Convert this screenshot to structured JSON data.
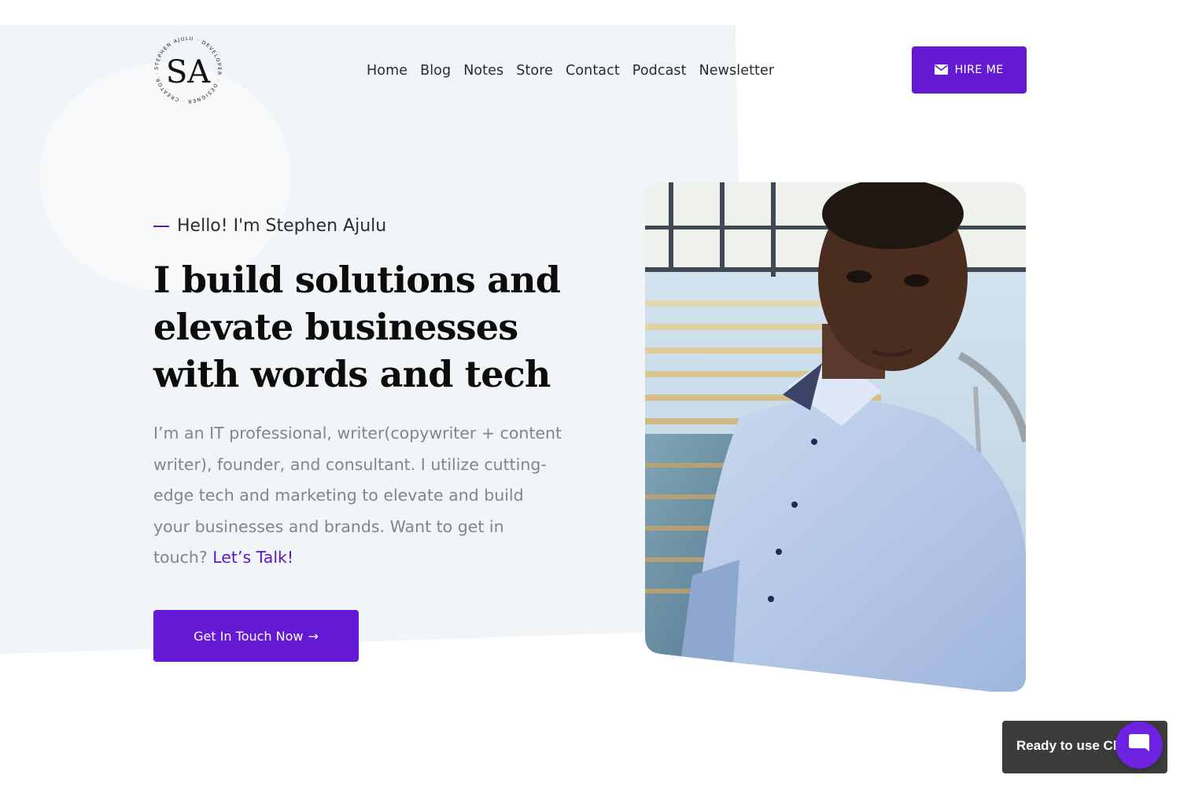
{
  "brand": {
    "logo_monogram": "SA",
    "logo_ring_text": "STEPHEN AJULU · DEVELOPER · DESIGNER · CREATOR · WRITER ·"
  },
  "nav": {
    "items": [
      {
        "label": "Home"
      },
      {
        "label": "Blog"
      },
      {
        "label": "Notes"
      },
      {
        "label": "Store"
      },
      {
        "label": "Contact"
      },
      {
        "label": "Podcast"
      },
      {
        "label": "Newsletter"
      }
    ]
  },
  "header": {
    "hire_button": {
      "label": "HIRE ME",
      "icon": "envelope-icon"
    }
  },
  "hero": {
    "kicker": "Hello! I'm Stephen Ajulu",
    "headline": "I build solutions and elevate businesses with words and tech",
    "bio": "I’m an IT professional, writer(copywriter + content writer), founder, and consultant. I utilize cutting-edge tech and marketing to elevate and build your businesses and brands. Want to get in touch? ",
    "bio_link": "Let’s Talk!",
    "cta_label": "Get In Touch Now",
    "cta_arrow": "→",
    "photo_icon": "portrait-photo"
  },
  "chat": {
    "bubble_text": "Ready to use Chat?",
    "launcher_icon": "chat-icon"
  },
  "colors": {
    "accent": "#6419d4",
    "hero_bg": "#f1f5f7",
    "text_muted": "#84848c",
    "chat_bubble": "#3c3c3c"
  }
}
